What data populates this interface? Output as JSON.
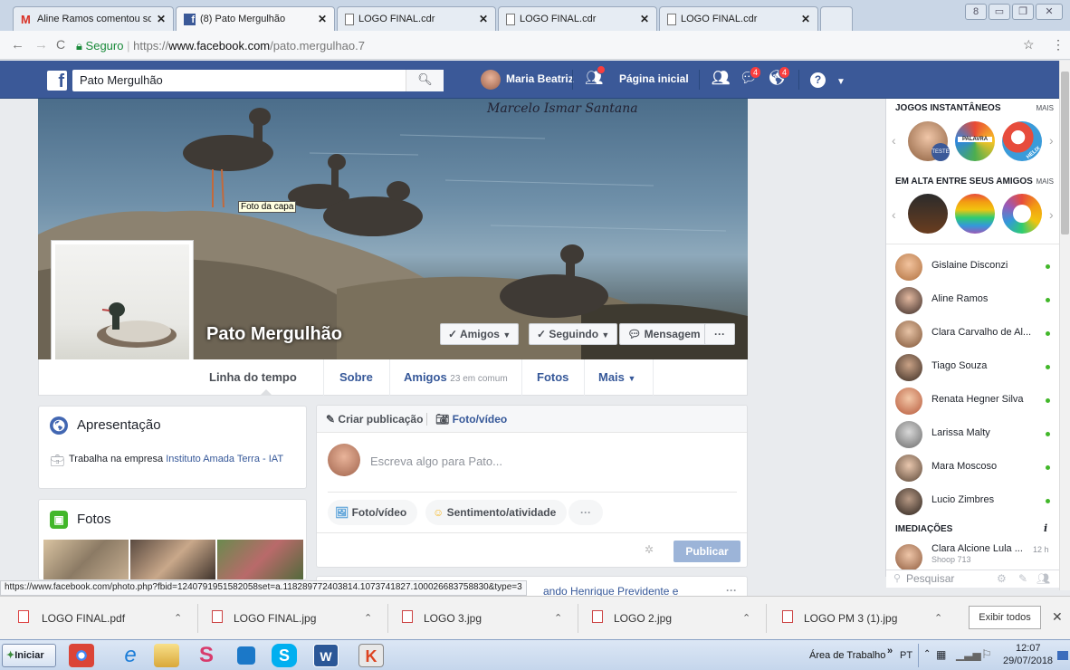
{
  "browser": {
    "tabs": [
      {
        "label": "Aline Ramos comentou sobr",
        "icon": "gmail-icon"
      },
      {
        "label": "(8) Pato Mergulhão",
        "icon": "facebook-icon"
      },
      {
        "label": "LOGO FINAL.cdr",
        "icon": "document-icon"
      },
      {
        "label": "LOGO FINAL.cdr",
        "icon": "document-icon"
      },
      {
        "label": "LOGO FINAL.cdr",
        "icon": "document-icon"
      }
    ],
    "url_secure": "Seguro",
    "url_prefix": "https://",
    "url_domain": "www.facebook.com",
    "url_path": "/pato.mergulhao.7"
  },
  "fbbar": {
    "search_value": "Pato Mergulhão",
    "user_name": "Maria Beatriz",
    "home_label": "Página inicial",
    "messages_count": "4",
    "notifications_count": "4"
  },
  "cover": {
    "signature": "Marcelo Ismar Santana",
    "tooltip": "Foto da capa"
  },
  "profile": {
    "name": "Pato Mergulhão",
    "btn_friends": "Amigos",
    "btn_following": "Seguindo",
    "btn_message": "Mensagem",
    "btn_more": "···",
    "tabs": {
      "timeline": "Linha do tempo",
      "about": "Sobre",
      "friends": "Amigos",
      "friends_sub": "23 em comum",
      "photos": "Fotos",
      "more": "Mais"
    }
  },
  "intro": {
    "title": "Apresentação",
    "work_prefix": "Trabalha na empresa",
    "work_link": "Instituto Amada Terra - IAT"
  },
  "photos_card": {
    "title": "Fotos"
  },
  "composer": {
    "create_post": "Criar publicação",
    "photo_video_tab": "Foto/vídeo",
    "placeholder": "Escreva algo para Pato...",
    "photo_video_btn": "Foto/vídeo",
    "feeling_btn": "Sentimento/atividade",
    "more_btn": "···",
    "publish": "Publicar"
  },
  "next_post": {
    "text": "ando Henrique Previdente e",
    "more": "···"
  },
  "sidebar": {
    "games_title": "JOGOS INSTANTÂNEOS",
    "games_more": "MAIS",
    "trending_title": "EM ALTA ENTRE SEUS AMIGOS",
    "trending_more": "MAIS",
    "game_labels": [
      "TESTE",
      "PALAVRA",
      "HELIX"
    ],
    "friends": [
      "Gislaine Disconzi",
      "Aline Ramos",
      "Clara Carvalho de Al...",
      "Tiago Souza",
      "Renata Hegner Silva",
      "Larissa Malty",
      "Mara Moscoso",
      "Lucio Zimbres"
    ],
    "nearby_title": "IMEDIAÇÕES",
    "nearby_name": "Clara Alcione Lula ...",
    "nearby_time": "12 h",
    "nearby_place": "Shoop 713",
    "search_placeholder": "Pesquisar"
  },
  "status_url": "https://www.facebook.com/photo.php?fbid=1240791951582058set=a.118289772403814.1073741827.100026683758830&type=3",
  "downloads": {
    "items": [
      "LOGO FINAL.pdf",
      "LOGO FINAL.jpg",
      "LOGO 3.jpg",
      "LOGO 2.jpg",
      "LOGO PM 3 (1).jpg"
    ],
    "show_all": "Exibir todos"
  },
  "taskbar": {
    "start": "Iniciar",
    "desktop_label": "Área de Trabalho",
    "lang": "PT",
    "time": "12:07",
    "date": "29/07/2018"
  },
  "colors": {
    "fb_blue": "#3b5998",
    "link": "#365899",
    "online": "#42b72a",
    "badge": "#fa3e3e",
    "publish": "#9cb4d8"
  }
}
